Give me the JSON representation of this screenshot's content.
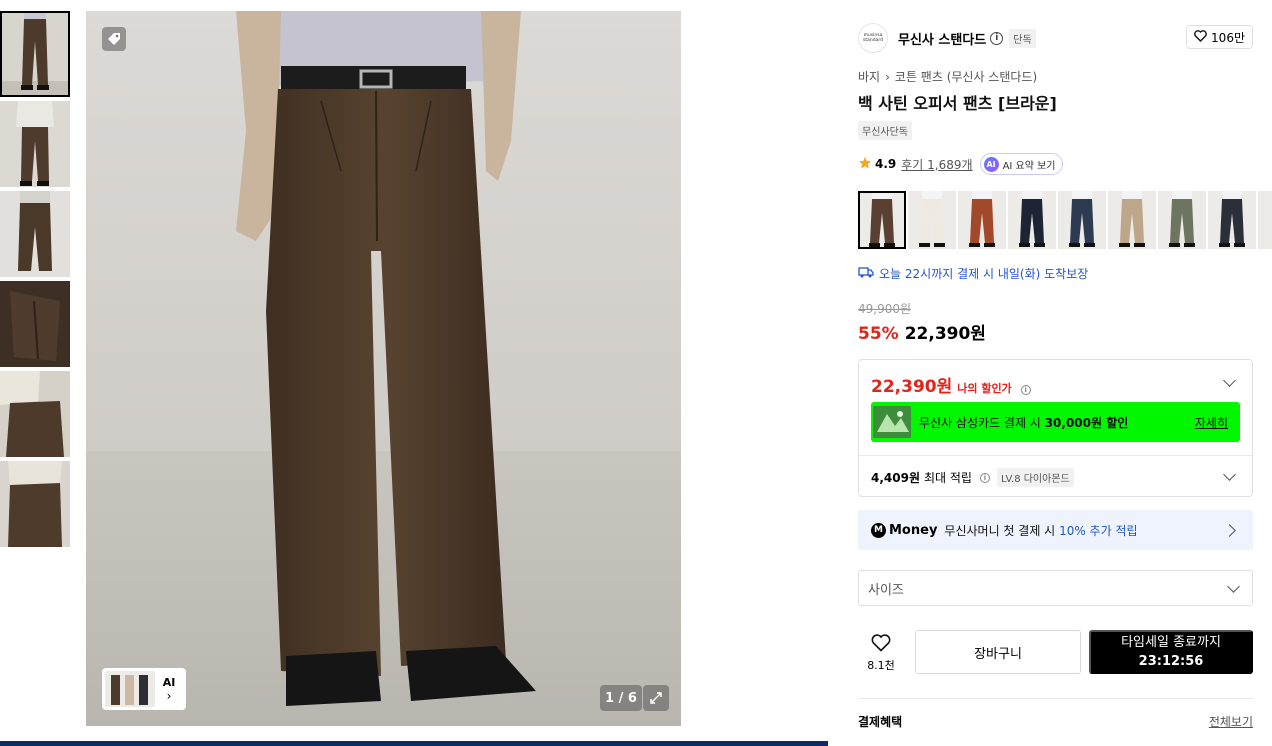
{
  "gallery": {
    "thumbnails": [
      {
        "name": "thumb-front-full",
        "selected": true
      },
      {
        "name": "thumb-front-shirt",
        "selected": false
      },
      {
        "name": "thumb-front-close",
        "selected": false
      },
      {
        "name": "thumb-fabric-detail",
        "selected": false
      },
      {
        "name": "thumb-side-detail",
        "selected": false
      },
      {
        "name": "thumb-back-detail",
        "selected": false
      }
    ],
    "pager": "1 / 6",
    "ai_label": "AI"
  },
  "brand": {
    "logo_line1": "musinsa",
    "logo_line2": "standard",
    "name": "무신사 스탠다드",
    "info_glyph": "i",
    "exclusive_badge": "단독",
    "likes": "106만"
  },
  "breadcrumb": {
    "items": [
      "바지",
      "코튼 팬츠 (무신사 스탠다드)"
    ]
  },
  "product": {
    "title": "백 사틴 오피서 팬츠 [브라운]",
    "exclusive_tag": "무신사단독",
    "rating": "4.9",
    "reviews": "후기 1,689개",
    "ai_summary": "AI 요약 보기",
    "ai_badge": "AI"
  },
  "colors": [
    {
      "name": "brown",
      "hex": "#5a4030",
      "selected": true
    },
    {
      "name": "white",
      "hex": "#eeeae2"
    },
    {
      "name": "rust",
      "hex": "#a3492b"
    },
    {
      "name": "navy",
      "hex": "#1d2433"
    },
    {
      "name": "dark-denim",
      "hex": "#2c3b52"
    },
    {
      "name": "beige",
      "hex": "#bda68a"
    },
    {
      "name": "olive",
      "hex": "#6d7560"
    },
    {
      "name": "charcoal",
      "hex": "#2b2f38"
    }
  ],
  "delivery": {
    "text": "오늘 22시까지 결제 시 내일(화) 도착보장"
  },
  "price": {
    "original": "49,900원",
    "discount": "55%",
    "sale": "22,390원"
  },
  "benefits": {
    "my_price": "22,390원",
    "my_price_label": "나의 할인가",
    "card_prefix": "무신사 삼성카드 결제 시",
    "card_amount": "30,000원 할인",
    "card_detail": "자세히",
    "points_amount": "4,409원",
    "points_label": "최대 적립",
    "level_badge": "LV.8 다이아몬드"
  },
  "money": {
    "logo_m": "M",
    "logo_text": "Money",
    "text_prefix": "무신사머니 첫 결제 시",
    "text_highlight": "10% 추가 적립"
  },
  "size_select": {
    "placeholder": "사이즈"
  },
  "actions": {
    "wishlist_count": "8.1천",
    "cart_label": "장바구니",
    "sale_label": "타임세일 종료까지",
    "sale_timer": "23:12:56"
  },
  "payment": {
    "heading": "결제혜택",
    "view_all": "전체보기"
  },
  "colors_theme": {
    "accent_red": "#e2231a",
    "accent_blue": "#2457c5",
    "card_green": "#00f700"
  }
}
